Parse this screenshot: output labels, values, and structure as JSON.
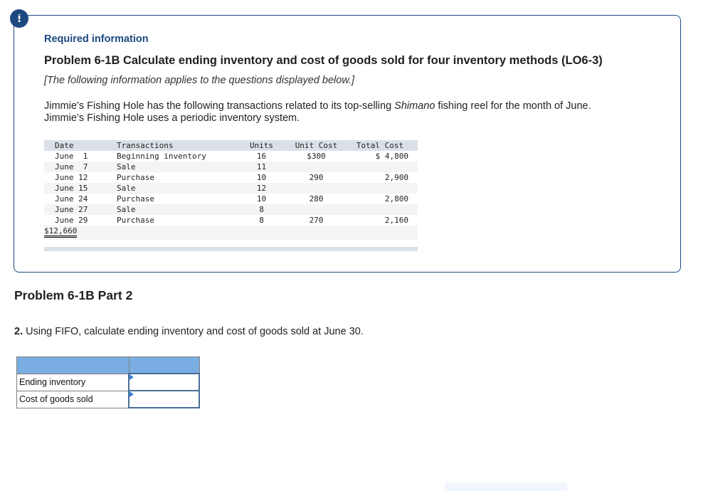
{
  "alert": {
    "icon": "!"
  },
  "info_box": {
    "heading": "Required information",
    "problem_title": "Problem 6-1B Calculate ending inventory and cost of goods sold for four inventory methods (LO6-3)",
    "note": "[The following information applies to the questions displayed below.]",
    "description": {
      "part1": "Jimmie’s Fishing Hole has the following transactions related to its top-selling ",
      "emphasis": "Shimano",
      "part2": " fishing reel for the month of June.",
      "line2": "Jimmie’s Fishing Hole uses a periodic inventory system."
    }
  },
  "transactions_table": {
    "headers": {
      "date": "Date",
      "transaction": "Transactions",
      "units": "Units",
      "unit_cost": "Unit Cost",
      "total_cost": "Total Cost"
    },
    "rows": [
      {
        "date": "June  1",
        "transaction": "Beginning inventory",
        "units": "16",
        "unit_cost": "$300",
        "total_cost": "$ 4,800"
      },
      {
        "date": "June  7",
        "transaction": "Sale",
        "units": "11",
        "unit_cost": "",
        "total_cost": ""
      },
      {
        "date": "June 12",
        "transaction": "Purchase",
        "units": "10",
        "unit_cost": "290",
        "total_cost": "2,900"
      },
      {
        "date": "June 15",
        "transaction": "Sale",
        "units": "12",
        "unit_cost": "",
        "total_cost": ""
      },
      {
        "date": "June 24",
        "transaction": "Purchase",
        "units": "10",
        "unit_cost": "280",
        "total_cost": "2,800"
      },
      {
        "date": "June 27",
        "transaction": "Sale",
        "units": "8",
        "unit_cost": "",
        "total_cost": ""
      },
      {
        "date": "June 29",
        "transaction": "Purchase",
        "units": "8",
        "unit_cost": "270",
        "total_cost": "2,160"
      }
    ],
    "total": "$12,660"
  },
  "part": {
    "title": "Problem 6-1B Part 2",
    "question_number": "2.",
    "question_text": " Using FIFO, calculate ending inventory and cost of goods sold at June 30."
  },
  "answer_table": {
    "rows": [
      {
        "label": "Ending inventory",
        "value": ""
      },
      {
        "label": "Cost of goods sold",
        "value": ""
      }
    ]
  },
  "colors": {
    "accent": "#1c4980",
    "table_header": "#dbe0e8",
    "answer_header": "#7aaee3"
  }
}
